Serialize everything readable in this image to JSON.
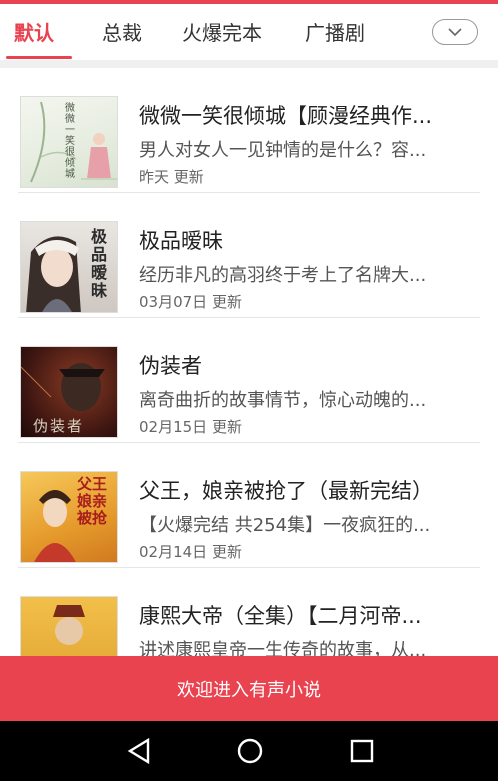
{
  "tabs": [
    {
      "label": "默认",
      "active": true
    },
    {
      "label": "总裁",
      "active": false
    },
    {
      "label": "火爆完本",
      "active": false
    },
    {
      "label": "广播剧",
      "active": false
    }
  ],
  "books": [
    {
      "title": "微微一笑很倾城【顾漫经典作...",
      "desc": "男人对女人一见钟情的是什么？容...",
      "meta": "昨天 更新",
      "cover_text": "微微一笑很倾城"
    },
    {
      "title": "极品暧昧",
      "desc": "经历非凡的高羽终于考上了名牌大...",
      "meta": "03月07日 更新",
      "cover_text": "极品暧昧"
    },
    {
      "title": "伪装者",
      "desc": "离奇曲折的故事情节，惊心动魄的...",
      "meta": "02月15日 更新",
      "cover_text": "伪装者"
    },
    {
      "title": "父王，娘亲被抢了（最新完结）",
      "desc": "【火爆完结 共254集】一夜疯狂的...",
      "meta": "02月14日 更新",
      "cover_text": "父王娘亲被抢"
    },
    {
      "title": "康熙大帝（全集）【二月河帝...",
      "desc": "讲述康熙皇帝一生传奇的故事，从...",
      "meta": "",
      "cover_text": ""
    }
  ],
  "bottom_action": {
    "label": "欢迎进入有声小说"
  },
  "colors": {
    "accent": "#e8434f"
  }
}
